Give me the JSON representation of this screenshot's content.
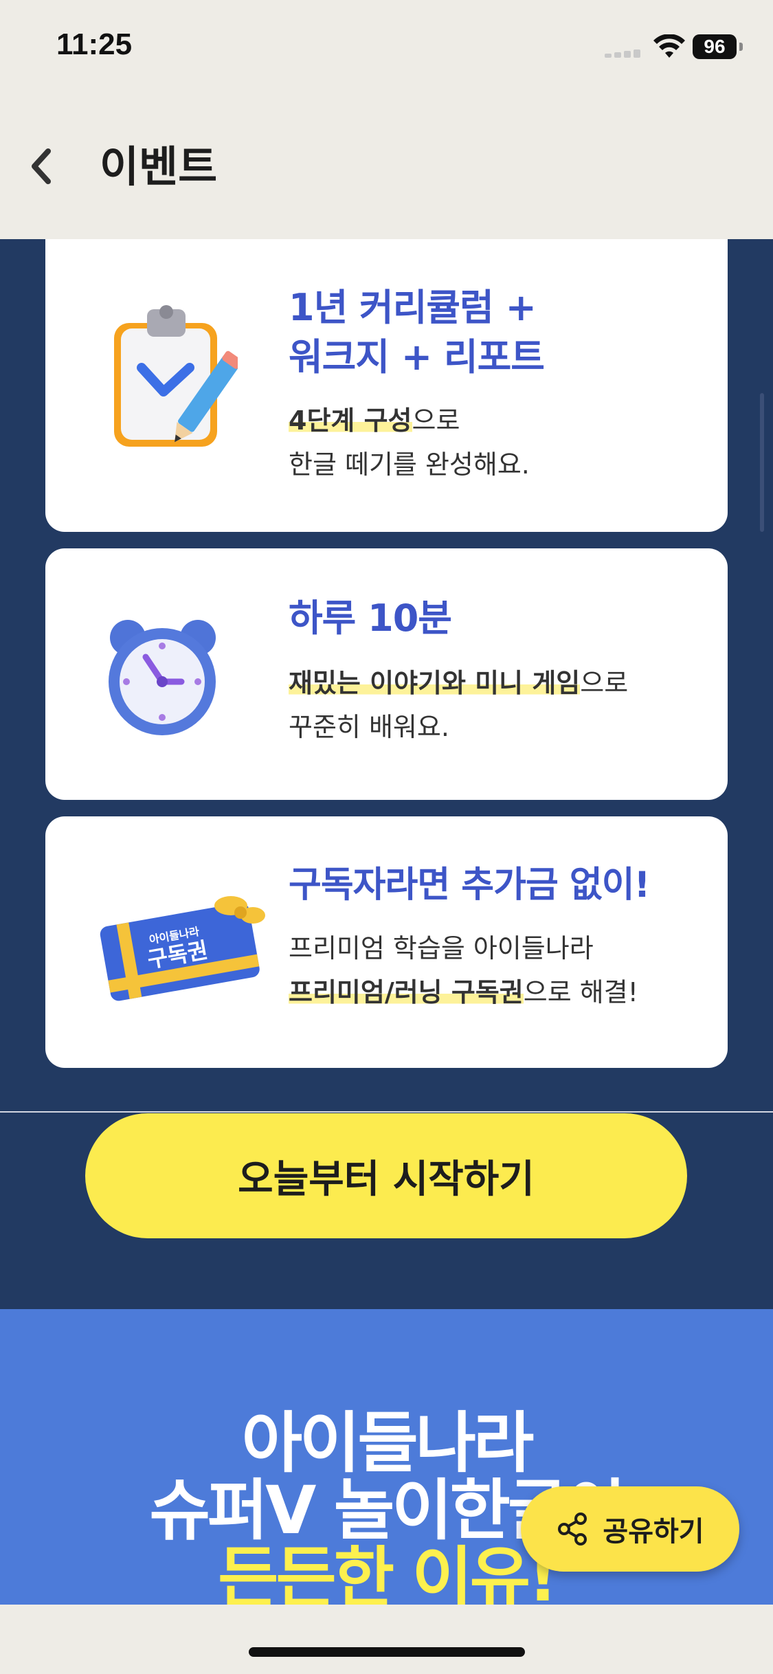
{
  "status_bar": {
    "time": "11:25",
    "battery": "96"
  },
  "header": {
    "title": "이벤트"
  },
  "cards": [
    {
      "title_line1": "1년 커리큘럼 +",
      "title_line2": "워크지 + 리포트",
      "desc_line1_highlight": "4단계 구성",
      "desc_line1_rest": "으로",
      "desc_line2": "한글 떼기를 완성해요."
    },
    {
      "title_line1": "하루 10분",
      "desc_line1_highlight": "재밌는 이야기와 미니 게임",
      "desc_line1_rest": "으로",
      "desc_line2": "꾸준히 배워요."
    },
    {
      "title_line1": "구독자라면 추가금 없이!",
      "desc_line1": "프리미엄 학습을 아이들나라",
      "desc_line2_highlight": "프리미엄/러닝 구독권",
      "desc_line2_rest": "으로 해결!",
      "ticket_small": "아이들나라",
      "ticket_big": "구독권"
    }
  ],
  "cta": {
    "label": "오늘부터 시작하기"
  },
  "promo": {
    "line1": "아이들나라",
    "line2": "슈퍼V 놀이한글이",
    "line3": "든든한 이유!"
  },
  "share_button": {
    "label": "공유하기"
  },
  "colors": {
    "navy": "#223a62",
    "accent_blue": "#3d55c7",
    "promo_blue": "#4d7bd9",
    "yellow": "#fceb4f"
  }
}
